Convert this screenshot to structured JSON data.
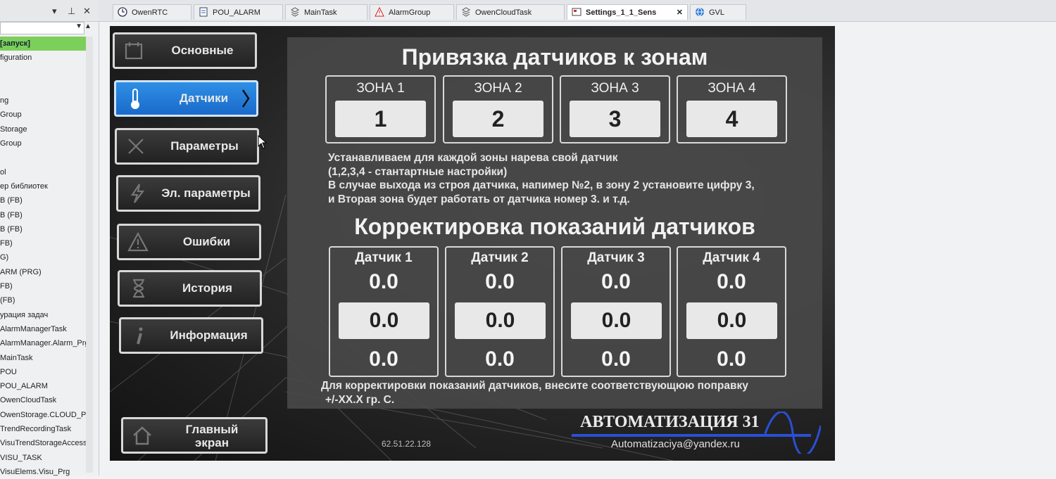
{
  "tree": {
    "items": [
      {
        "label": "[запуск]",
        "selected": true
      },
      {
        "label": "figuration"
      },
      {
        "label": ""
      },
      {
        "label": ""
      },
      {
        "label": "ng"
      },
      {
        "label": "Group"
      },
      {
        "label": "Storage"
      },
      {
        "label": "Group"
      },
      {
        "label": ""
      },
      {
        "label": "ol"
      },
      {
        "label": "ер библиотек"
      },
      {
        "label": "В (FB)"
      },
      {
        "label": "В (FB)"
      },
      {
        "label": "В (FB)"
      },
      {
        "label": "FB)"
      },
      {
        "label": "G)"
      },
      {
        "label": "ARM (PRG)"
      },
      {
        "label": "FB)"
      },
      {
        "label": "(FB)"
      },
      {
        "label": "урация задач"
      },
      {
        "label": "AlarmManagerTask"
      },
      {
        "label": "AlarmManager.Alarm_Prg"
      },
      {
        "label": "MainTask"
      },
      {
        "label": "POU"
      },
      {
        "label": "POU_ALARM"
      },
      {
        "label": "OwenCloudTask"
      },
      {
        "label": "OwenStorage.CLOUD_PR"
      },
      {
        "label": "TrendRecordingTask"
      },
      {
        "label": "VisuTrendStorageAccess"
      },
      {
        "label": "VISU_TASK"
      },
      {
        "label": "VisuElems.Visu_Prg"
      }
    ]
  },
  "tabs": [
    {
      "label": "OwenRTC",
      "icon": "clock-icon"
    },
    {
      "label": "POU_ALARM",
      "icon": "document-icon"
    },
    {
      "label": "MainTask",
      "icon": "task-icon"
    },
    {
      "label": "AlarmGroup",
      "icon": "warning-icon"
    },
    {
      "label": "OwenCloudTask",
      "icon": "task-icon"
    },
    {
      "label": "Settings_1_1_Sens",
      "icon": "visu-icon",
      "active": true,
      "close": "✕"
    },
    {
      "label": "GVL",
      "icon": "globe-icon"
    }
  ],
  "hmi": {
    "menu": [
      {
        "label": "Основные",
        "icon": "calendar-icon"
      },
      {
        "label": "Датчики",
        "icon": "thermometer-icon",
        "active": true
      },
      {
        "label": "Параметры",
        "icon": "tools-icon"
      },
      {
        "label": "Эл. параметры",
        "icon": "lightning-icon"
      },
      {
        "label": "Ошибки",
        "icon": "warning-icon"
      },
      {
        "label": "История",
        "icon": "hourglass-icon"
      },
      {
        "label": "Информация",
        "icon": "info-icon"
      }
    ],
    "home_button": {
      "line1": "Главный",
      "line2": "экран",
      "icon": "home-icon"
    },
    "title_zones": "Привязка датчиков к зонам",
    "zones": [
      {
        "title": "ЗОНА 1",
        "value": "1"
      },
      {
        "title": "ЗОНА 2",
        "value": "2"
      },
      {
        "title": "ЗОНА 3",
        "value": "3"
      },
      {
        "title": "ЗОНА 4",
        "value": "4"
      }
    ],
    "zone_note": [
      "Устанавливаем для каждой зоны нарева свой датчик",
      "(1,2,3,4 - стантартные настройки)",
      "В случае выхода из строя датчика, напимер №2, в зону 2 установите цифру 3,",
      "и Вторая зона будет работать от датчика номер 3. и т.д."
    ],
    "title_correction": "Корректировка показаний датчиков",
    "sensors": [
      {
        "title": "Датчик 1",
        "reading": "0.0",
        "correction": "0.0",
        "result": "0.0"
      },
      {
        "title": "Датчик 2",
        "reading": "0.0",
        "correction": "0.0",
        "result": "0.0"
      },
      {
        "title": "Датчик 3",
        "reading": "0.0",
        "correction": "0.0",
        "result": "0.0"
      },
      {
        "title": "Датчик 4",
        "reading": "0.0",
        "correction": "0.0",
        "result": "0.0"
      }
    ],
    "correction_note": [
      "Для корректировки показаний датчиков, внесите соответствующюю поправку",
      "+/-XX.X гр. С."
    ],
    "brand": "АВТОМАТИЗАЦИЯ 31",
    "email": "Automatizaciya@yandex.ru",
    "ip": "62.51.22.128"
  },
  "colors": {
    "active_button": "#1f7ad8",
    "selected_tree": "#7ccf5a",
    "brand_line": "#2a4fd6"
  }
}
